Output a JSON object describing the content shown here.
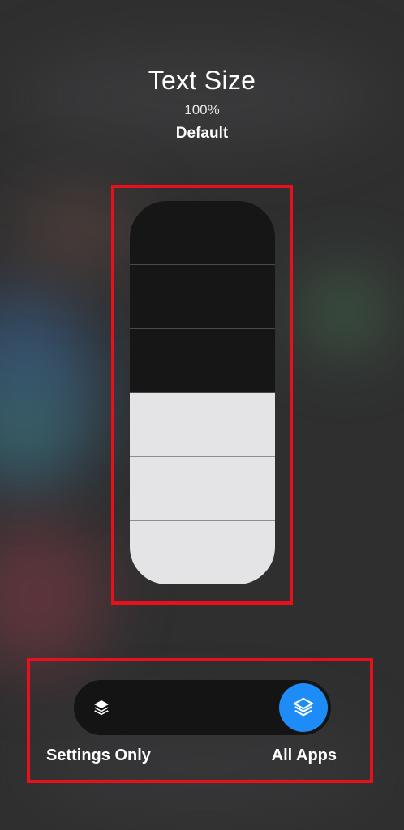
{
  "header": {
    "title": "Text Size",
    "percent": "100%",
    "level_label": "Default"
  },
  "slider": {
    "total_steps": 6,
    "filled_steps": 3,
    "colors": {
      "filled": "#e4e4e6",
      "empty": "#161617"
    }
  },
  "scope_toggle": {
    "left_label": "Settings Only",
    "right_label": "All Apps",
    "selected": "All Apps",
    "left_icon": "layers-icon",
    "right_icon": "layers-icon",
    "accent_color": "#1e8cf6"
  },
  "annotations": {
    "highlight_color": "#e8101a"
  }
}
